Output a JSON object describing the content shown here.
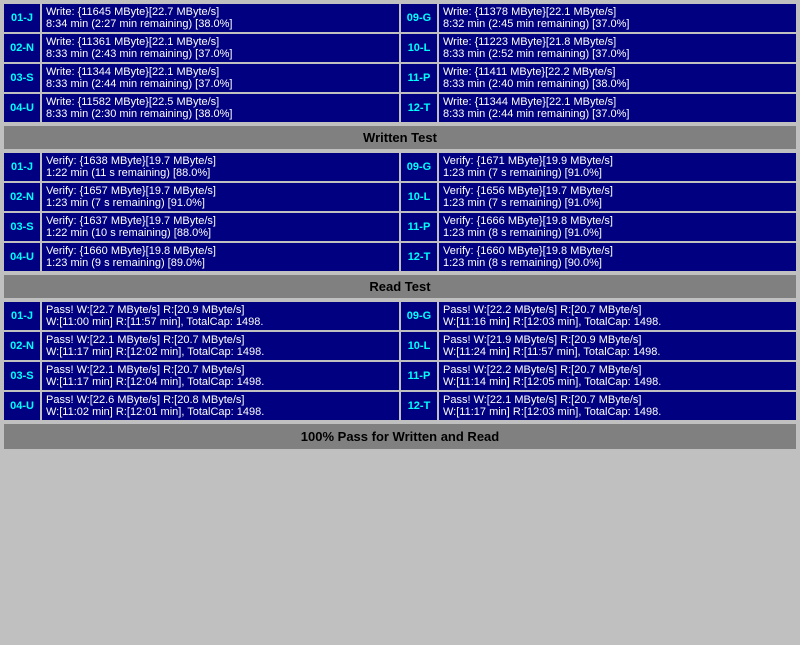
{
  "write_section": {
    "rows": [
      {
        "left_label": "01-J",
        "left_line1": "Write: {11645 MByte}[22.7 MByte/s]",
        "left_line2": "8:34 min (2:27 min remaining)  [38.0%]",
        "right_label": "09-G",
        "right_line1": "Write: {11378 MByte}[22.1 MByte/s]",
        "right_line2": "8:32 min (2:45 min remaining)  [37.0%]"
      },
      {
        "left_label": "02-N",
        "left_line1": "Write: {11361 MByte}[22.1 MByte/s]",
        "left_line2": "8:33 min (2:43 min remaining)  [37.0%]",
        "right_label": "10-L",
        "right_line1": "Write: {11223 MByte}[21.8 MByte/s]",
        "right_line2": "8:33 min (2:52 min remaining)  [37.0%]"
      },
      {
        "left_label": "03-S",
        "left_line1": "Write: {11344 MByte}[22.1 MByte/s]",
        "left_line2": "8:33 min (2:44 min remaining)  [37.0%]",
        "right_label": "11-P",
        "right_line1": "Write: {11411 MByte}[22.2 MByte/s]",
        "right_line2": "8:33 min (2:40 min remaining)  [38.0%]"
      },
      {
        "left_label": "04-U",
        "left_line1": "Write: {11582 MByte}[22.5 MByte/s]",
        "left_line2": "8:33 min (2:30 min remaining)  [38.0%]",
        "right_label": "12-T",
        "right_line1": "Write: {11344 MByte}[22.1 MByte/s]",
        "right_line2": "8:33 min (2:44 min remaining)  [37.0%]"
      }
    ],
    "header": "Written Test"
  },
  "verify_section": {
    "rows": [
      {
        "left_label": "01-J",
        "left_line1": "Verify: {1638 MByte}[19.7 MByte/s]",
        "left_line2": "1:22 min (11 s remaining)   [88.0%]",
        "right_label": "09-G",
        "right_line1": "Verify: {1671 MByte}[19.9 MByte/s]",
        "right_line2": "1:23 min (7 s remaining)   [91.0%]"
      },
      {
        "left_label": "02-N",
        "left_line1": "Verify: {1657 MByte}[19.7 MByte/s]",
        "left_line2": "1:23 min (7 s remaining)   [91.0%]",
        "right_label": "10-L",
        "right_line1": "Verify: {1656 MByte}[19.7 MByte/s]",
        "right_line2": "1:23 min (7 s remaining)   [91.0%]"
      },
      {
        "left_label": "03-S",
        "left_line1": "Verify: {1637 MByte}[19.7 MByte/s]",
        "left_line2": "1:22 min (10 s remaining)   [88.0%]",
        "right_label": "11-P",
        "right_line1": "Verify: {1666 MByte}[19.8 MByte/s]",
        "right_line2": "1:23 min (8 s remaining)   [91.0%]"
      },
      {
        "left_label": "04-U",
        "left_line1": "Verify: {1660 MByte}[19.8 MByte/s]",
        "left_line2": "1:23 min (9 s remaining)   [89.0%]",
        "right_label": "12-T",
        "right_line1": "Verify: {1660 MByte}[19.8 MByte/s]",
        "right_line2": "1:23 min (8 s remaining)   [90.0%]"
      }
    ],
    "header": "Read Test"
  },
  "pass_section": {
    "rows": [
      {
        "left_label": "01-J",
        "left_line1": "Pass! W:[22.7 MByte/s] R:[20.9 MByte/s]",
        "left_line2": "W:[11:00 min] R:[11:57 min], TotalCap: 1498.",
        "right_label": "09-G",
        "right_line1": "Pass! W:[22.2 MByte/s] R:[20.7 MByte/s]",
        "right_line2": "W:[11:16 min] R:[12:03 min], TotalCap: 1498."
      },
      {
        "left_label": "02-N",
        "left_line1": "Pass! W:[22.1 MByte/s] R:[20.7 MByte/s]",
        "left_line2": "W:[11:17 min] R:[12:02 min], TotalCap: 1498.",
        "right_label": "10-L",
        "right_line1": "Pass! W:[21.9 MByte/s] R:[20.9 MByte/s]",
        "right_line2": "W:[11:24 min] R:[11:57 min], TotalCap: 1498."
      },
      {
        "left_label": "03-S",
        "left_line1": "Pass! W:[22.1 MByte/s] R:[20.7 MByte/s]",
        "left_line2": "W:[11:17 min] R:[12:04 min], TotalCap: 1498.",
        "right_label": "11-P",
        "right_line1": "Pass! W:[22.2 MByte/s] R:[20.7 MByte/s]",
        "right_line2": "W:[11:14 min] R:[12:05 min], TotalCap: 1498."
      },
      {
        "left_label": "04-U",
        "left_line1": "Pass! W:[22.6 MByte/s] R:[20.8 MByte/s]",
        "left_line2": "W:[11:02 min] R:[12:01 min], TotalCap: 1498.",
        "right_label": "12-T",
        "right_line1": "Pass! W:[22.1 MByte/s] R:[20.7 MByte/s]",
        "right_line2": "W:[11:17 min] R:[12:03 min], TotalCap: 1498."
      }
    ],
    "header": "Read Test",
    "footer": "100% Pass for Written and Read"
  }
}
